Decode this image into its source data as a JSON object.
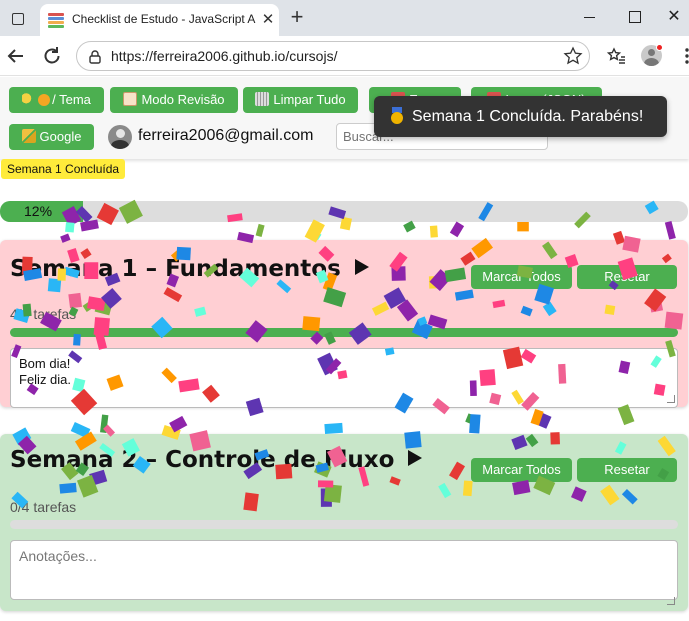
{
  "browser": {
    "tab_title": "Checklist de Estudo - JavaScript A",
    "url": "https://ferreira2006.github.io/cursojs/",
    "tab_close": "✕",
    "new_tab": "+",
    "window_close": "✕"
  },
  "header": {
    "tema_label": "/ Tema",
    "revisao_label": "Modo Revisão",
    "limpar_label": "Limpar Tudo",
    "export_label": "Expo",
    "import_label": "Impor (JSON)",
    "google_label": "Google",
    "user_email": "ferreira2006@gmail.com",
    "search_placeholder": "Buscar..."
  },
  "toast": {
    "text": "Semana 1 Concluída. Parabéns!"
  },
  "badge": {
    "text": "Semana 1 Concluída"
  },
  "overall_progress": {
    "label": "12%",
    "percent": 12
  },
  "weeks": [
    {
      "title": "Semana 1 – Fundamentos",
      "mark_all_label": "Marcar Todos",
      "reset_label": "Resetar",
      "count": "4/4 tarefas",
      "progress": 100,
      "notes": "Bom dia!\nFeliz dia."
    },
    {
      "title": "Semana 2 – Controle de Fluxo",
      "mark_all_label": "Marcar Todos",
      "reset_label": "Resetar",
      "count": "0/4 tarefas",
      "progress": 0,
      "notes_placeholder": "Anotações..."
    }
  ],
  "colors": {
    "accent": "#4caf50",
    "week1_bg": "#ffcfd3",
    "week2_bg": "#c8e6c9",
    "badge": "#ffeb3b",
    "toast_bg": "#333333"
  }
}
